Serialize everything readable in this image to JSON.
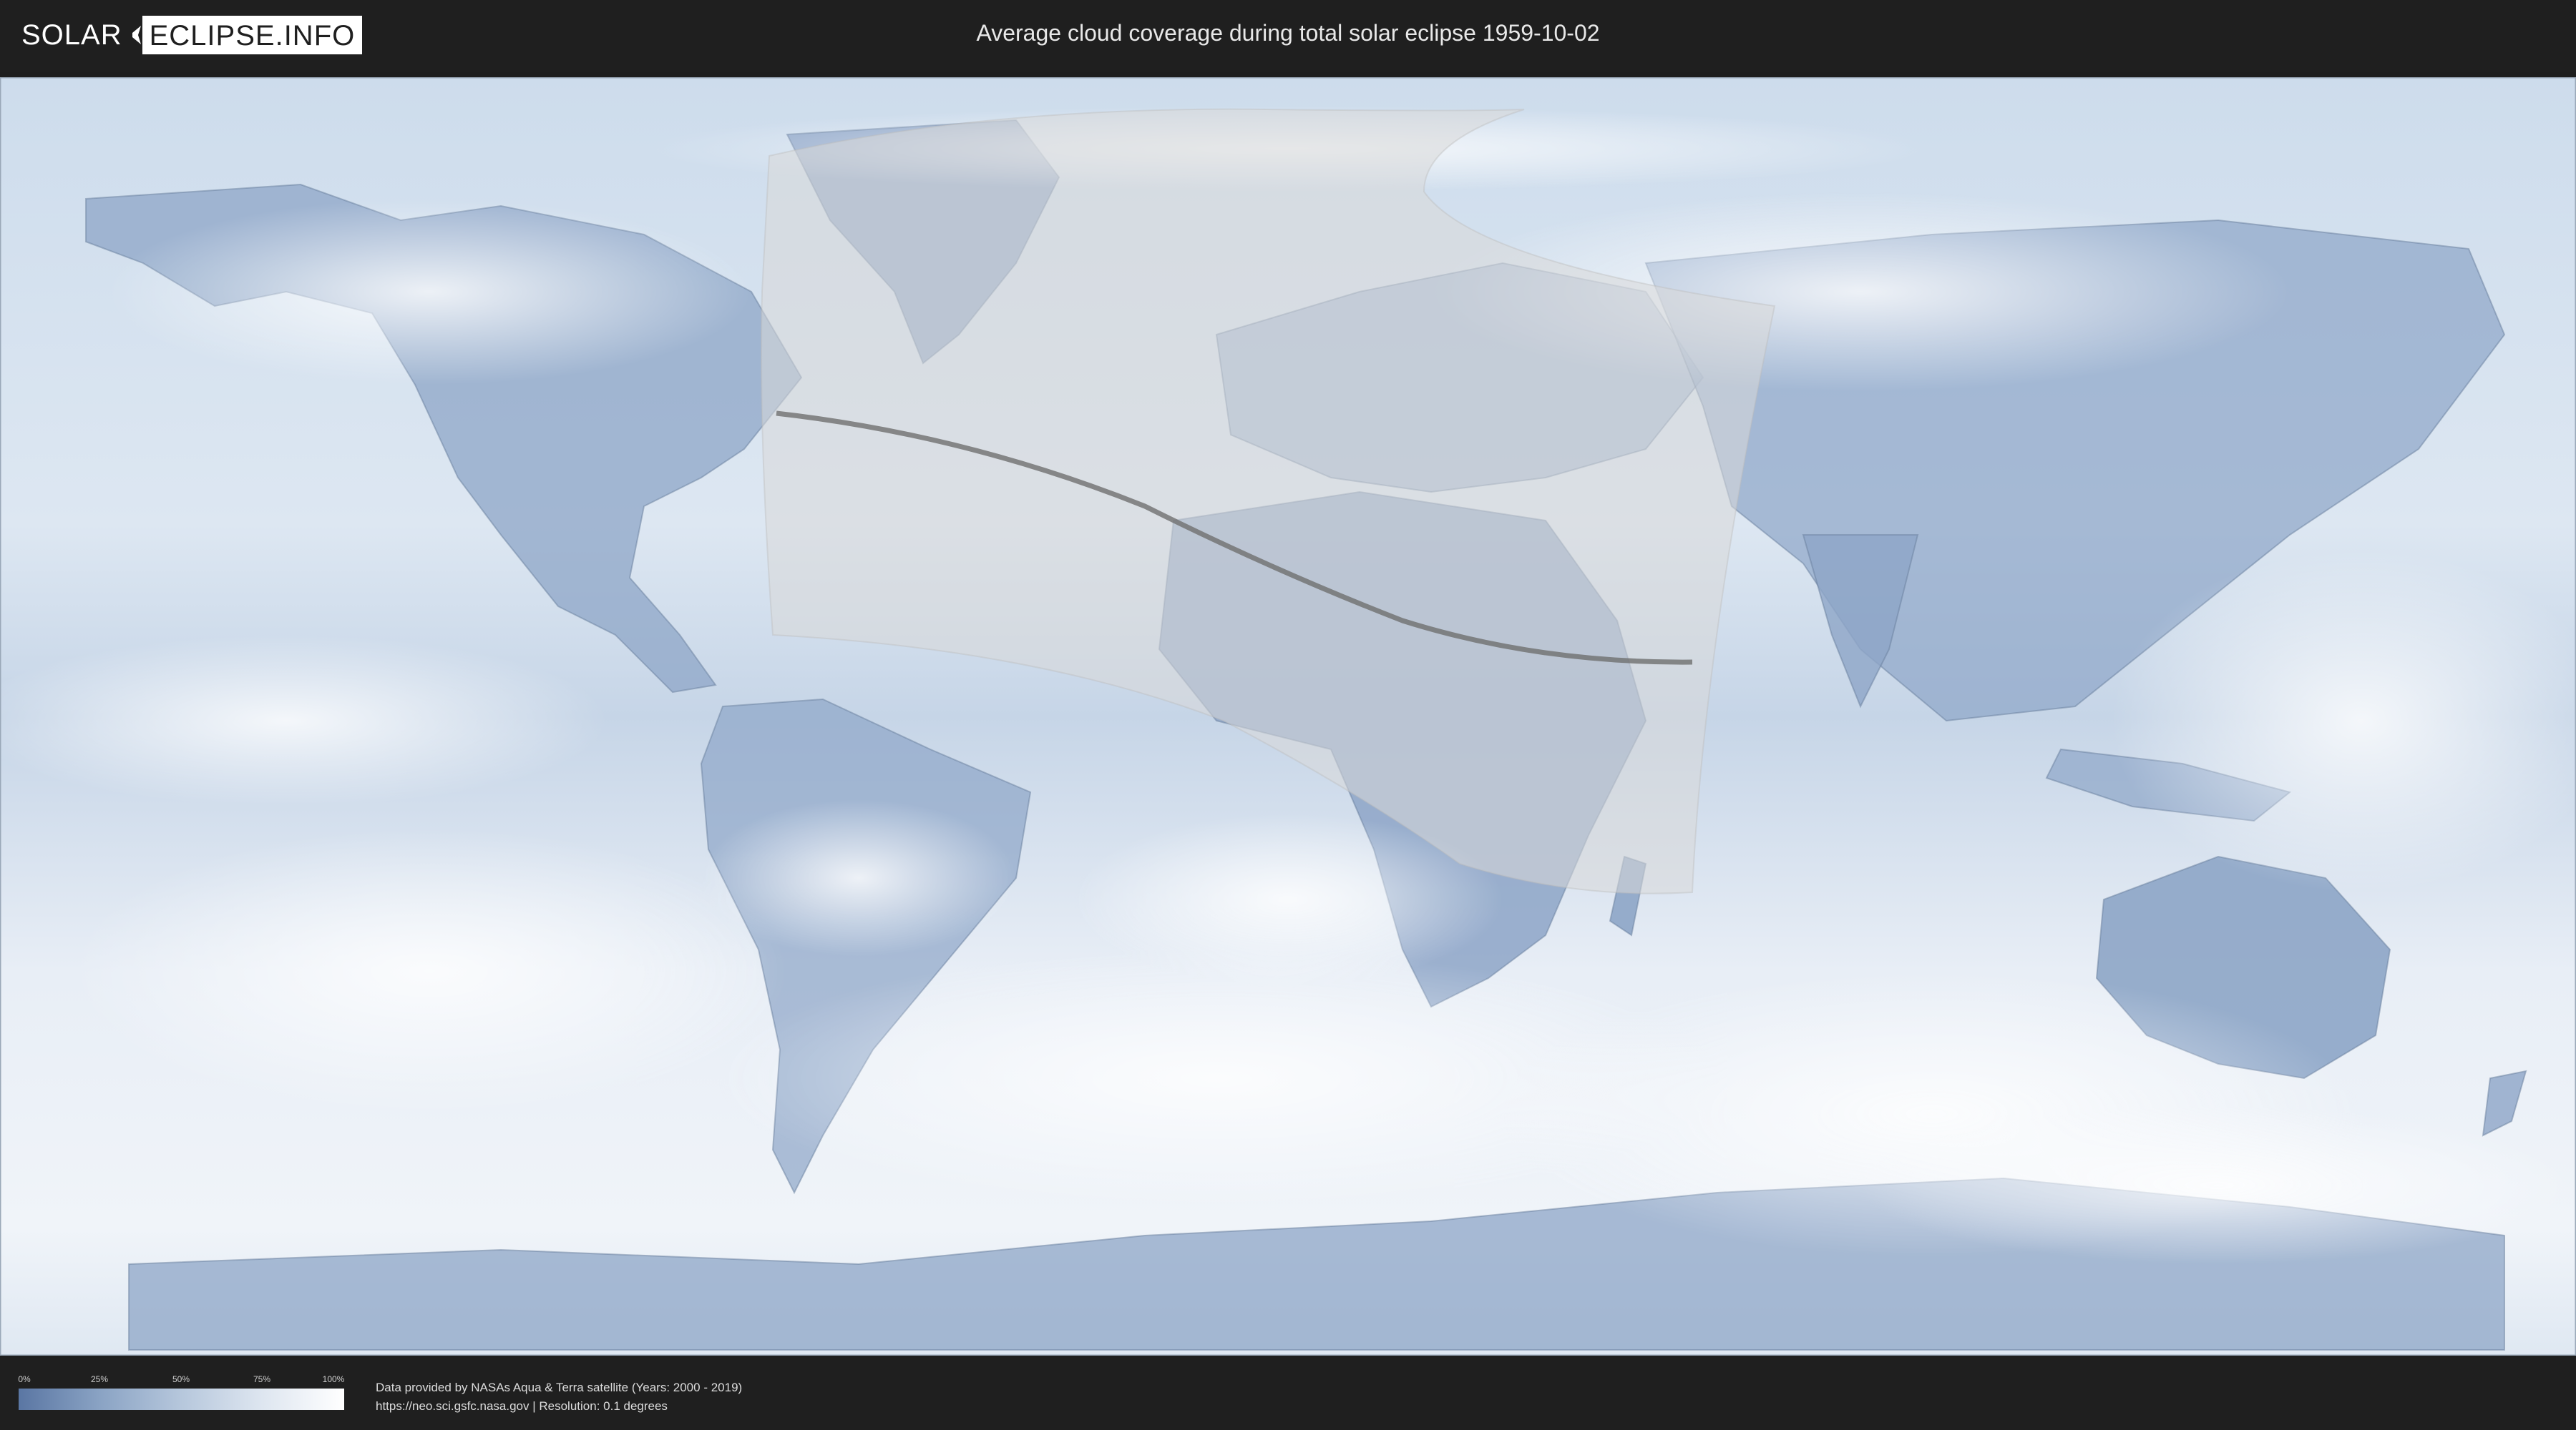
{
  "header": {
    "logo_left": "SOLAR",
    "logo_right": "ECLIPSE.INFO",
    "title": "Average cloud coverage during total solar eclipse 1959-10-02"
  },
  "map": {
    "ocean_color": "#d6e1ee",
    "land_color": "#7f98bd",
    "cloud_color": "#f4f7fb",
    "visibility_zone_color": "#d9d9d9",
    "totality_path_color": "#6f6f6f"
  },
  "legend": {
    "ticks": [
      "0%",
      "25%",
      "50%",
      "75%",
      "100%"
    ],
    "gradient_start": "#5a76a3",
    "gradient_end": "#ffffff"
  },
  "footer": {
    "credit_line_1": "Data provided by NASAs Aqua & Terra satellite (Years: 2000 - 2019)",
    "credit_line_2": "https://neo.sci.gsfc.nasa.gov | Resolution: 0.1 degrees"
  }
}
